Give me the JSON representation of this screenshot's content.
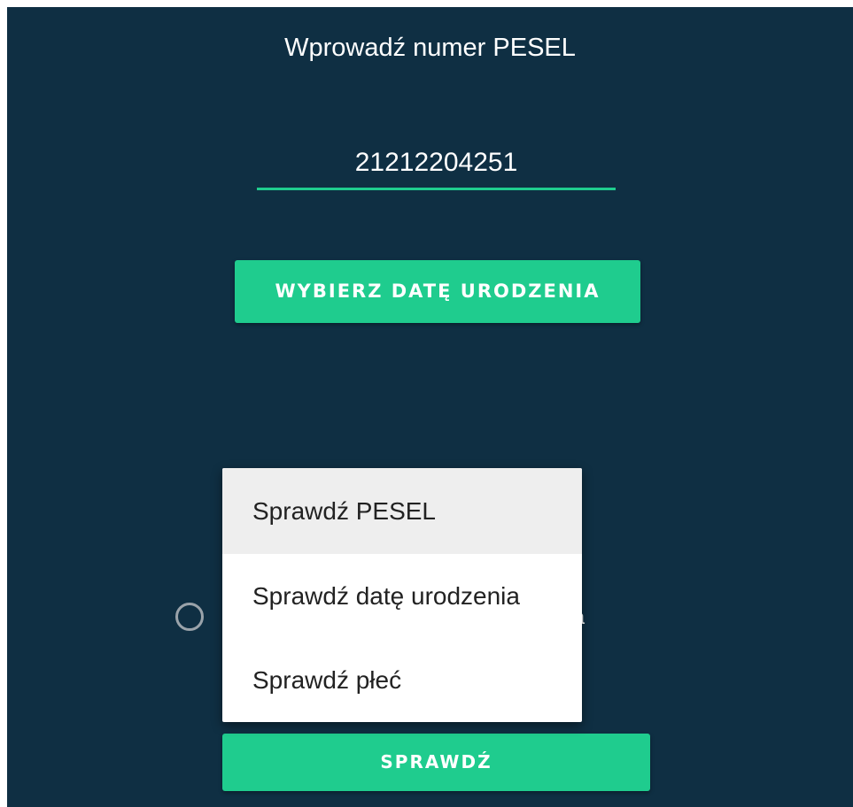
{
  "header": {
    "title": "Wprowadź numer PESEL"
  },
  "pesel_input": {
    "value": "21212204251"
  },
  "buttons": {
    "select_birthdate": "WYBIERZ DATĘ URODZENIA",
    "check": "SPRAWDŹ"
  },
  "radio": {
    "label_visible_tail": "zna",
    "checked": false
  },
  "dropdown": {
    "items": [
      {
        "label": "Sprawdź PESEL",
        "highlighted": true
      },
      {
        "label": "Sprawdź datę urodzenia",
        "highlighted": false
      },
      {
        "label": "Sprawdź płeć",
        "highlighted": false
      }
    ]
  },
  "colors": {
    "background": "#0f2f43",
    "accent": "#1fcc8e",
    "menu_background": "#ffffff",
    "menu_highlight": "#eeeeee"
  }
}
